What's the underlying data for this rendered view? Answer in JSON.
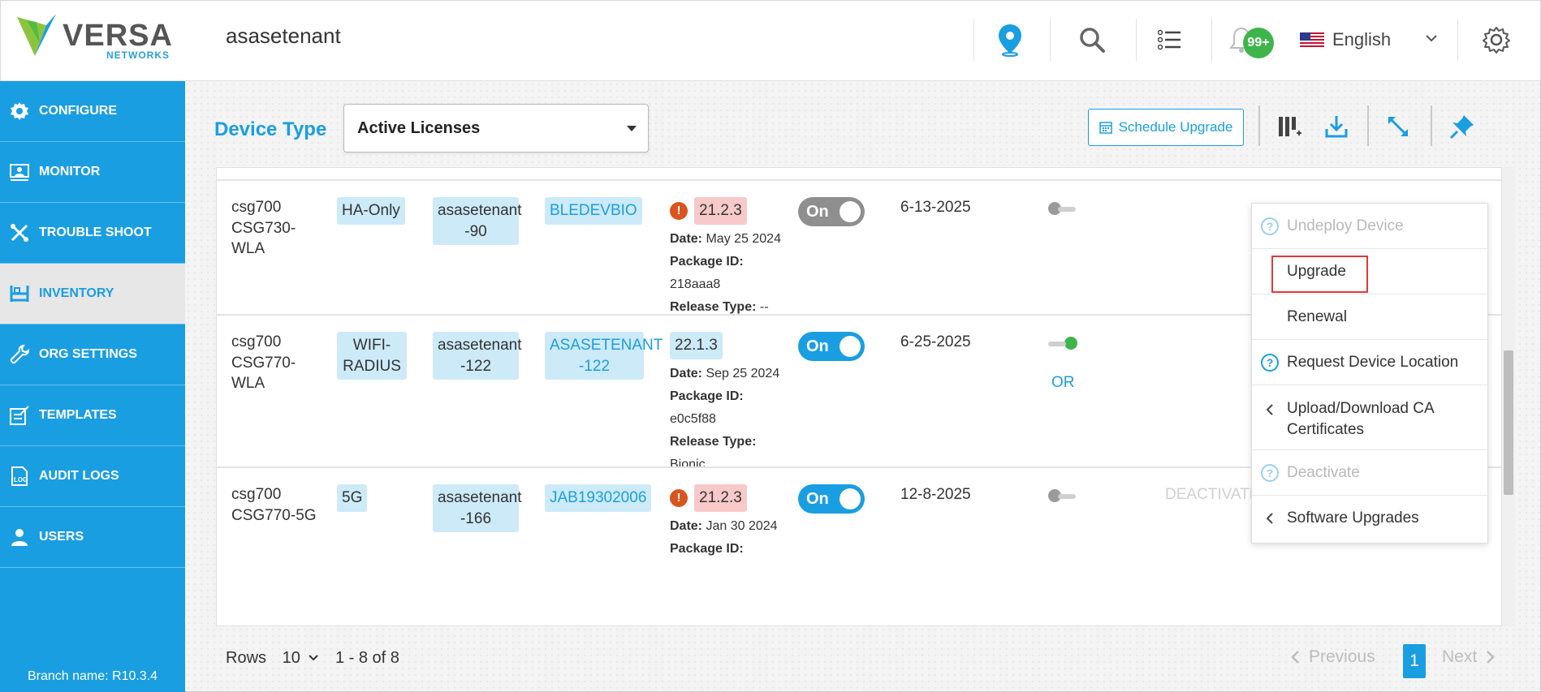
{
  "header": {
    "logo_text": "VERSA",
    "logo_sub": "NETWORKS",
    "tenant": "asasetenant",
    "notifications_badge": "99+",
    "language": "English"
  },
  "sidebar": {
    "items": [
      {
        "label": "CONFIGURE",
        "icon": "gear-icon"
      },
      {
        "label": "MONITOR",
        "icon": "monitor-icon"
      },
      {
        "label": "TROUBLE SHOOT",
        "icon": "tools-icon"
      },
      {
        "label": "INVENTORY",
        "icon": "inventory-icon"
      },
      {
        "label": "ORG SETTINGS",
        "icon": "wrench-icon"
      },
      {
        "label": "TEMPLATES",
        "icon": "templates-icon"
      },
      {
        "label": "AUDIT LOGS",
        "icon": "log-icon"
      },
      {
        "label": "USERS",
        "icon": "user-icon"
      }
    ],
    "branch": "Branch name: R10.3.4"
  },
  "toolbar": {
    "device_type_label": "Device Type",
    "device_type_value": "Active Licenses",
    "schedule_upgrade": "Schedule Upgrade"
  },
  "rows": [
    {
      "model_line1": "csg700",
      "model_line2": "CSG730-",
      "model_line3": "WLA",
      "license": "HA-Only",
      "tenant_line1": "asasetenant",
      "tenant_line2": "-90",
      "serial": "BLEDEVBIO",
      "version": "21.2.3",
      "date_label": "Date:",
      "date": "May 25 2024",
      "package_label": "Package ID:",
      "package_id": "218aaa8",
      "release_label": "Release Type:",
      "release_type": "--",
      "toggle": "On",
      "expiry": "6-13-2025"
    },
    {
      "model_line1": "csg700",
      "model_line2": "CSG770-",
      "model_line3": "WLA",
      "license_line1": "WIFI-",
      "license_line2": "RADIUS",
      "tenant_line1": "asasetenant",
      "tenant_line2": "-122",
      "serial_line1": "ASASETENANT",
      "serial_line2": "-122",
      "version": "22.1.3",
      "date_label": "Date:",
      "date": "Sep 25 2024",
      "package_label": "Package ID:",
      "package_id": "e0c5f88",
      "release_label": "Release Type:",
      "release_type": "Bionic",
      "toggle": "On",
      "expiry": "6-25-2025",
      "partial_text": "OR"
    },
    {
      "model_line1": "csg700",
      "model_line2": "CSG770-5G",
      "license": "5G",
      "tenant_line1": "asasetenant",
      "tenant_line2": "-166",
      "serial": "JAB19302006",
      "version": "21.2.3",
      "date_label": "Date:",
      "date": "Jan 30 2024",
      "package_label": "Package ID:",
      "toggle": "On",
      "expiry": "12-8-2025",
      "action": "DEACTIVATE"
    }
  ],
  "context_menu": {
    "items": [
      {
        "label": "Undeploy Device",
        "disabled": true
      },
      {
        "label": "Upgrade",
        "disabled": false
      },
      {
        "label": "Renewal",
        "disabled": false
      },
      {
        "label": "Request Device Location",
        "disabled": false
      },
      {
        "label_line1": "Upload/Download CA",
        "label_line2": "Certificates",
        "disabled": false
      },
      {
        "label": "Deactivate",
        "disabled": true
      },
      {
        "label": "Software Upgrades",
        "disabled": false
      }
    ]
  },
  "footer": {
    "rows_label": "Rows",
    "rows_value": "10",
    "range": "1 - 8 of 8",
    "previous": "Previous",
    "current_page": "1",
    "next": "Next"
  },
  "colors": {
    "accent": "#1a9ee2",
    "success": "#3db54a",
    "warning": "#d9541e",
    "highlight": "#e03a3a"
  }
}
